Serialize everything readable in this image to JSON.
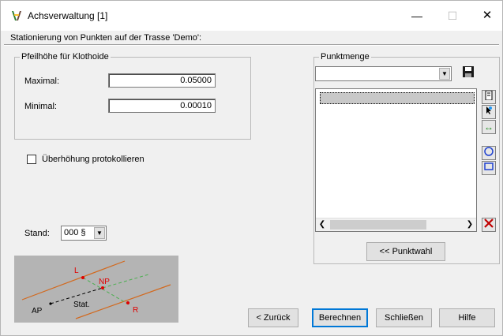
{
  "window": {
    "title": "Achsverwaltung [1]",
    "min_label": "—",
    "max_label": "☐",
    "close_label": "✕"
  },
  "subtitle": "Stationierung von Punkten auf der Trasse 'Demo':",
  "pfeilhoehe": {
    "title": "Pfeilhöhe für Klothoide",
    "maximal_label": "Maximal:",
    "maximal_value": "0.05000",
    "minimal_label": "Minimal:",
    "minimal_value": "0.00010"
  },
  "ueberhoehung": {
    "label": "Überhöhung protokollieren",
    "checked": false
  },
  "stand": {
    "label": "Stand:",
    "value": "000  §"
  },
  "punktmenge": {
    "title": "Punktmenge",
    "combo_value": "",
    "punktwahl_button": "<< Punktwahl"
  },
  "diagram": {
    "labels": {
      "L": "L",
      "NP": "NP",
      "AP": "AP",
      "Stat": "Stat.",
      "R": "R"
    },
    "colors": {
      "line": "#d2691e",
      "point": "#e00000",
      "dashed": "#4caf50",
      "background": "#b4b4b4"
    }
  },
  "buttons": {
    "zurueck": "< Zurück",
    "berechnen": "Berechnen",
    "schliessen": "Schließen",
    "hilfe": "Hilfe"
  },
  "icons": {
    "app": "caliper-icon",
    "save": "floppy-disk-icon",
    "tool1": "file-icon",
    "tool2": "pick-point-icon",
    "tool3": "horizontal-arrows-icon",
    "tool4": "circle-select-icon",
    "tool5": "rectangle-select-icon",
    "delete": "red-x-icon"
  }
}
